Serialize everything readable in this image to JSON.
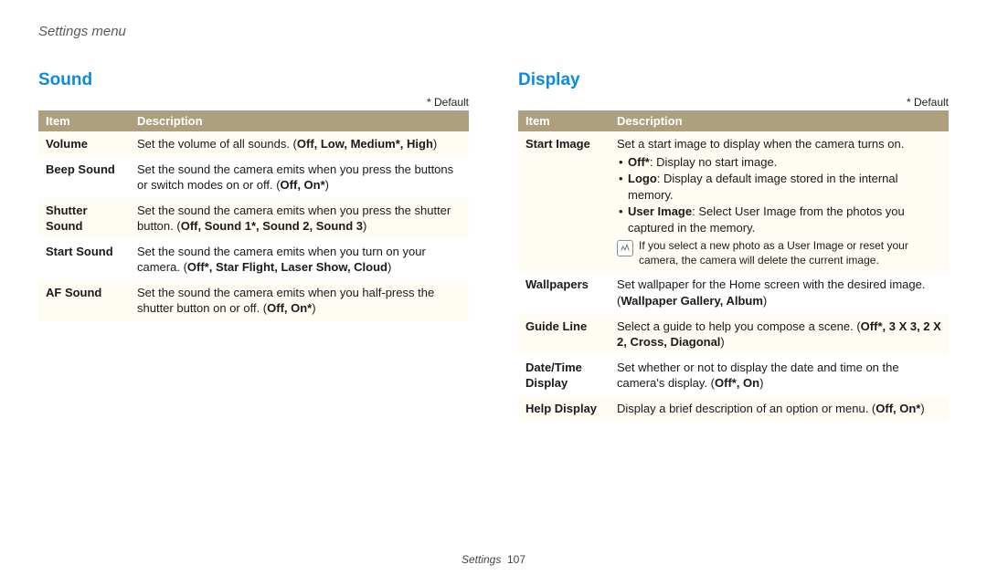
{
  "breadcrumb": "Settings menu",
  "default_note": "* Default",
  "headers": {
    "item": "Item",
    "description": "Description"
  },
  "footer": {
    "section": "Settings",
    "page": "107"
  },
  "sound": {
    "heading": "Sound",
    "rows": [
      {
        "item": "Volume",
        "desc_pre": "Set the volume of all sounds. (",
        "opts": "Off, Low, Medium*, High",
        "desc_post": ")"
      },
      {
        "item": "Beep Sound",
        "desc_pre": "Set the sound the camera emits when you press the buttons or switch modes on or off. (",
        "opts": "Off, On*",
        "desc_post": ")"
      },
      {
        "item": "Shutter Sound",
        "desc_pre": "Set the sound the camera emits when you press the shutter button. (",
        "opts": "Off, Sound 1*, Sound 2, Sound 3",
        "desc_post": ")"
      },
      {
        "item": "Start Sound",
        "desc_pre": "Set the sound the camera emits when you turn on your camera. (",
        "opts": "Off*, Star Flight, Laser Show, Cloud",
        "desc_post": ")"
      },
      {
        "item": "AF Sound",
        "desc_pre": "Set the sound the camera emits when you half-press the shutter button on or off. (",
        "opts": "Off, On*",
        "desc_post": ")"
      }
    ]
  },
  "display": {
    "heading": "Display",
    "start_image": {
      "item": "Start Image",
      "intro": "Set a start image to display when the camera turns on.",
      "bullets": [
        {
          "bold": "Off*",
          "rest": ": Display no start image."
        },
        {
          "bold": "Logo",
          "rest": ": Display a default image stored in the internal memory."
        },
        {
          "bold": "User Image",
          "rest": ": Select User Image from the photos you captured in the memory."
        }
      ],
      "note": "If you select a new photo as a User Image or reset your camera, the camera will delete the current image."
    },
    "rows_after": [
      {
        "item": "Wallpapers",
        "desc_pre": "Set wallpaper for the Home screen with the desired image. (",
        "opts": "Wallpaper Gallery, Album",
        "desc_post": ")"
      },
      {
        "item": "Guide Line",
        "desc_pre": "Select a guide to help you compose a scene. (",
        "opts": "Off*, 3 X 3, 2 X 2, Cross, Diagonal",
        "desc_post": ")"
      },
      {
        "item": "Date/Time Display",
        "desc_pre": "Set whether or not to display the date and time on the camera's display. (",
        "opts": "Off*, On",
        "desc_post": ")"
      },
      {
        "item": "Help Display",
        "desc_pre": "Display a brief description of an option or menu. (",
        "opts": "Off, On*",
        "desc_post": ")"
      }
    ]
  }
}
